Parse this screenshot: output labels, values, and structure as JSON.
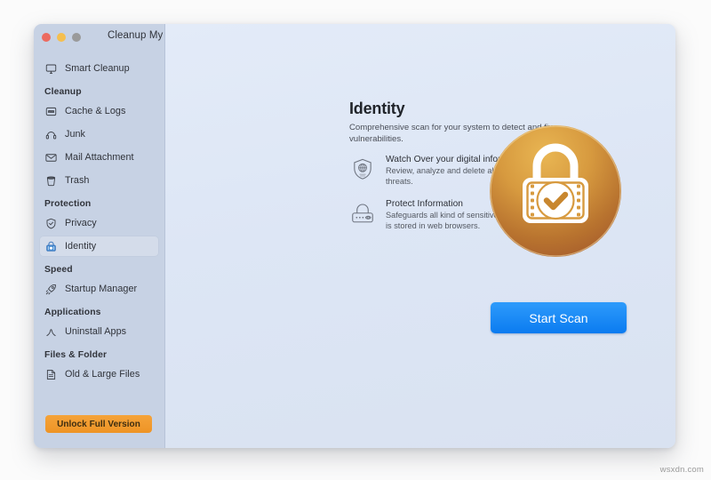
{
  "window": {
    "title": "Cleanup My System",
    "traffic_lights": [
      {
        "name": "close",
        "color": "#ec6a5f"
      },
      {
        "name": "minimize",
        "color": "#f5bf4f"
      },
      {
        "name": "zoom",
        "color": "#9a9a9a"
      }
    ]
  },
  "sidebar": {
    "top_items": [
      {
        "label": "Smart Cleanup",
        "icon": "monitor-icon",
        "selected": false
      }
    ],
    "sections": [
      {
        "title": "Cleanup",
        "items": [
          {
            "label": "Cache & Logs",
            "icon": "log-box-icon",
            "selected": false
          },
          {
            "label": "Junk",
            "icon": "junk-icon",
            "selected": false
          },
          {
            "label": "Mail Attachment",
            "icon": "mail-icon",
            "selected": false
          },
          {
            "label": "Trash",
            "icon": "trash-icon",
            "selected": false
          }
        ]
      },
      {
        "title": "Protection",
        "items": [
          {
            "label": "Privacy",
            "icon": "shield-check-icon",
            "selected": false
          },
          {
            "label": "Identity",
            "icon": "lock-badge-icon",
            "selected": true
          }
        ]
      },
      {
        "title": "Speed",
        "items": [
          {
            "label": "Startup Manager",
            "icon": "rocket-icon",
            "selected": false
          }
        ]
      },
      {
        "title": "Applications",
        "items": [
          {
            "label": "Uninstall Apps",
            "icon": "caret-up-icon",
            "selected": false
          }
        ]
      },
      {
        "title": "Files & Folder",
        "items": [
          {
            "label": "Old & Large Files",
            "icon": "document-icon",
            "selected": false
          }
        ]
      }
    ],
    "unlock_label": "Unlock Full Version",
    "unlock_color": "#f0982a"
  },
  "main": {
    "title": "Identity",
    "subtitle": "Comprehensive scan for your system to detect and fix vulnerabilities.",
    "features": [
      {
        "icon": "shield-globe-icon",
        "heading": "Watch Over your digital information.",
        "description": "Review, analyze and delete all identity exposing threats."
      },
      {
        "icon": "padlock-eye-icon",
        "heading": "Protect Information",
        "description": "Safeguards all kind of sensitive information which is stored in web browsers."
      }
    ],
    "badge": {
      "icon": "lock-check-badge-icon",
      "color_outer": "#e0a53c",
      "color_inner": "#b5702f"
    },
    "scan_button": {
      "label": "Start Scan",
      "color": "#1587f3"
    }
  },
  "watermark": "wsxdn.com"
}
